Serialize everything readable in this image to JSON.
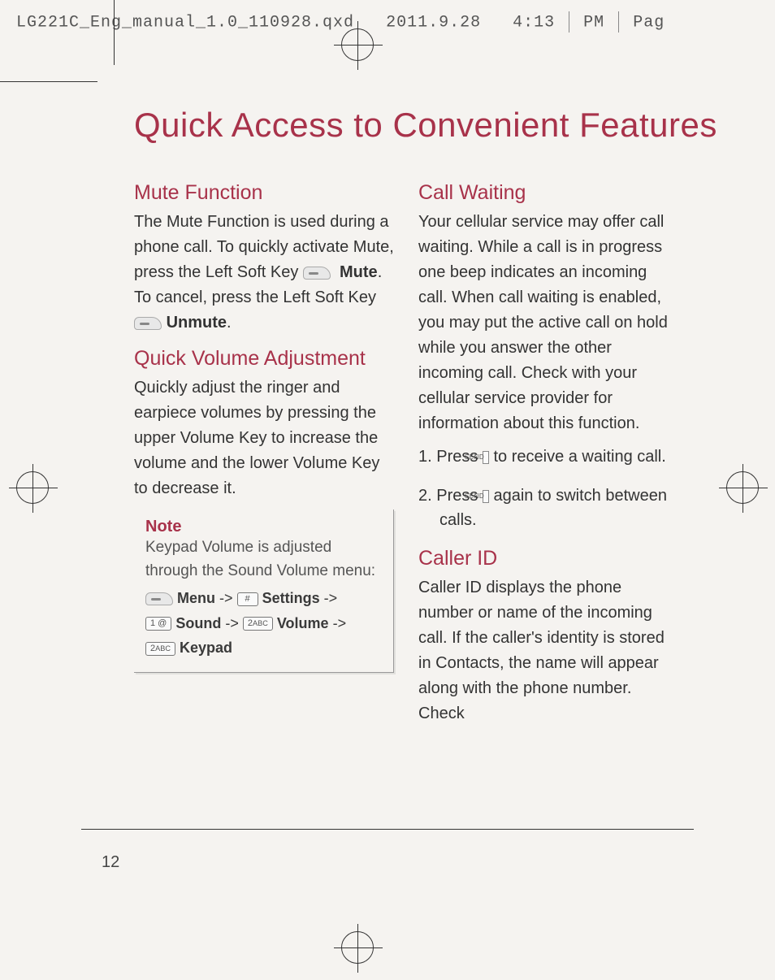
{
  "header": {
    "filename": "LG221C_Eng_manual_1.0_110928.qxd",
    "date": "2011.9.28",
    "time": "4:13",
    "ampm": "PM",
    "page_label": "Pag"
  },
  "page_title": "Quick Access to Convenient Features",
  "page_number": "12",
  "left": {
    "mute": {
      "heading": "Mute Function",
      "p1a": "The Mute Function is used during a phone call. To quickly activate Mute, press the Left Soft Key ",
      "mute_label": "Mute",
      "p1b": ". To cancel, press the Left Soft Key ",
      "unmute_label": "Unmute",
      "period": "."
    },
    "volume": {
      "heading": "Quick Volume Adjustment",
      "p": "Quickly adjust the ringer and earpiece volumes by pressing the upper Volume Key to increase the volume and the lower Volume Key to decrease it."
    },
    "note": {
      "title": "Note",
      "text": "Keypad Volume is adjusted through the Sound Volume menu:",
      "menu": "Menu",
      "settings": "Settings",
      "sound": "Sound",
      "volume": "Volume",
      "keypad": "Keypad",
      "arrow": "->"
    }
  },
  "right": {
    "waiting": {
      "heading": "Call Waiting",
      "p": "Your cellular service may offer call waiting. While a call is in progress one beep indicates an incoming call. When call waiting is enabled, you may put the active call on hold while you answer the other incoming call. Check with your cellular service provider for information about this function.",
      "step1_a": "1. Press ",
      "step1_b": " to receive a waiting call.",
      "step2_a": "2. Press ",
      "step2_b": " again to switch between calls.",
      "send": "SEND"
    },
    "callerid": {
      "heading": "Caller ID",
      "p": "Caller ID displays the phone number or name of the incoming call. If the caller's identity is stored in Contacts, the name will appear along with the phone number. Check"
    }
  }
}
